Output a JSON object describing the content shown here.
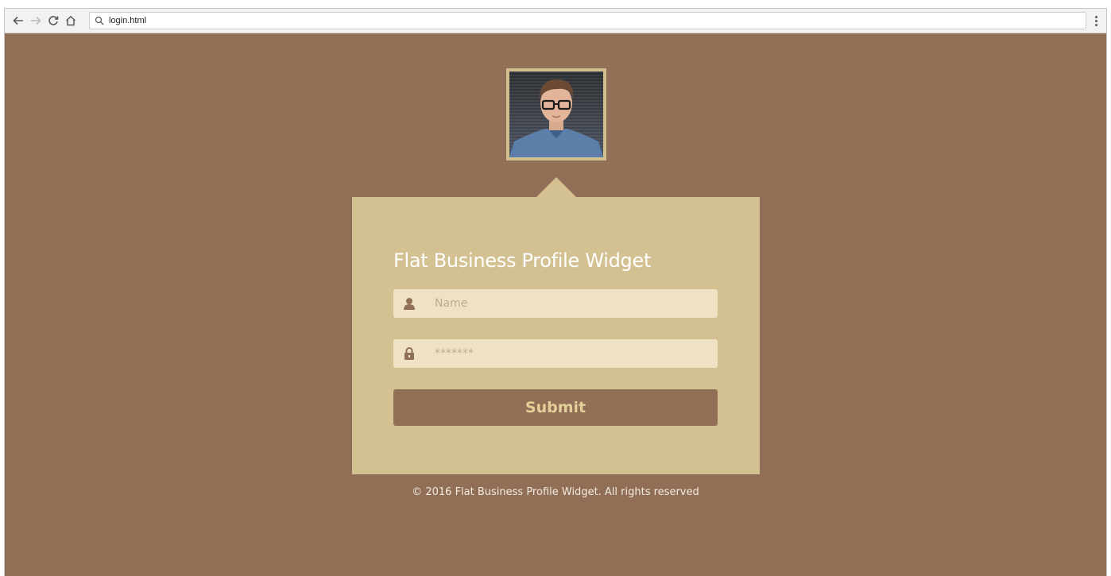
{
  "browser": {
    "address": "login.html",
    "icons": {
      "back": "arrow-left-icon",
      "forward": "arrow-right-icon",
      "reload": "reload-icon",
      "home": "home-icon",
      "search": "search-icon",
      "menu": "more-vertical-icon"
    }
  },
  "page": {
    "colors": {
      "background": "#916f56",
      "card": "#d3c191",
      "field": "#efe2c4",
      "button": "#916f56",
      "button_text": "#e3cf98"
    },
    "widget": {
      "title": "Flat Business Profile Widget",
      "name_placeholder": "Name",
      "password_placeholder": "*******",
      "submit_label": "Submit"
    },
    "footer": "© 2016 Flat Business Profile Widget. All rights reserved"
  }
}
